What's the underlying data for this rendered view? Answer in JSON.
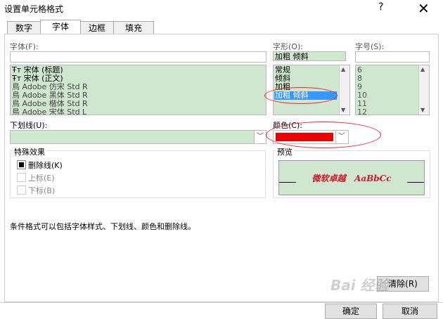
{
  "window": {
    "title": "设置单元格格式",
    "help": "?",
    "close": "✕"
  },
  "tabs": [
    "数字",
    "字体",
    "边框",
    "填充"
  ],
  "font": {
    "label": "字体(F):",
    "input": "",
    "items": [
      "宋体 (标题)",
      "宋体 (正文)",
      "Adobe 仿宋 Std R",
      "Adobe 黑体 Std R",
      "Adobe 楷体 Std R",
      "Adobe 宋体 Std L"
    ],
    "item_icons": [
      "Ŧт",
      "Ŧт",
      "鳥",
      "鳥",
      "鳥",
      "鳥"
    ]
  },
  "style": {
    "label": "字形(O):",
    "input": "加粗 倾斜",
    "items": [
      "常规",
      "倾斜",
      "加粗",
      "加粗 倾斜"
    ],
    "selected_index": 3
  },
  "size": {
    "label": "字号(S):",
    "input": "",
    "items": [
      "6",
      "8",
      "9",
      "10",
      "11",
      "12"
    ]
  },
  "underline": {
    "label": "下划线(U):",
    "value": ""
  },
  "color": {
    "label": "颜色(C):",
    "swatch": "#ee0000"
  },
  "effects": {
    "legend": "特殊效果",
    "strikethrough": "删除线(K)",
    "superscript": "上标(E)",
    "subscript": "下标(B)"
  },
  "preview": {
    "legend": "预览",
    "text": "微软卓越   AaBbCc",
    "color": "#d4142a"
  },
  "note": "条件格式可以包括字体样式、下划线、颜色和删除线。",
  "buttons": {
    "clear": "清除(R)",
    "ok": "确定",
    "cancel": "取消"
  },
  "watermark": "Bai 经验"
}
